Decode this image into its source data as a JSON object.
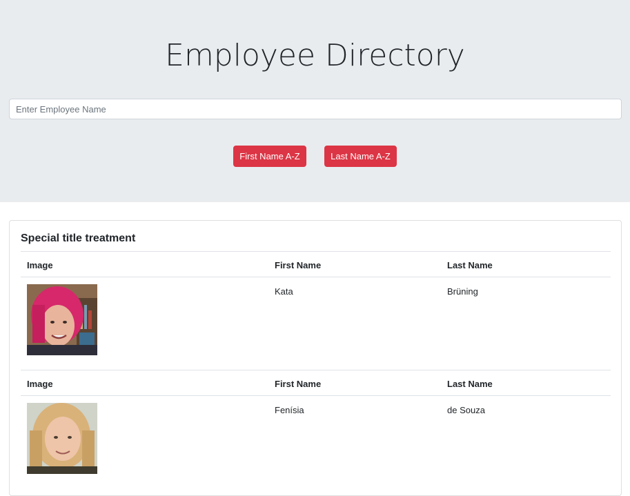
{
  "header": {
    "title": "Employee Directory"
  },
  "search": {
    "placeholder": "Enter Employee Name",
    "value": ""
  },
  "sort_buttons": {
    "first_name": "First Name A-Z",
    "last_name": "Last Name A-Z",
    "color": "#dc3545"
  },
  "card": {
    "title": "Special title treatment"
  },
  "table": {
    "columns": [
      "Image",
      "First Name",
      "Last Name"
    ],
    "employees": [
      {
        "first_name": "Kata",
        "last_name": "Brüning",
        "photo": "avatar-photo"
      },
      {
        "first_name": "Fenísia",
        "last_name": "de Souza",
        "photo": "avatar-photo"
      }
    ]
  }
}
